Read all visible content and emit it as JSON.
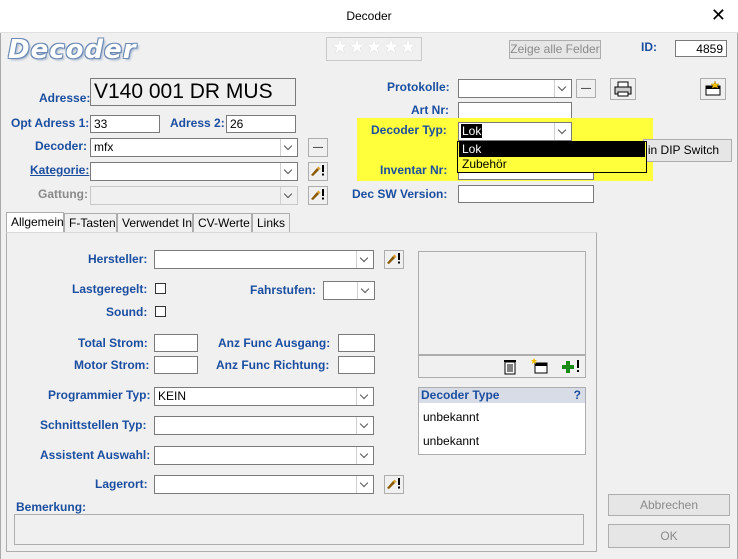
{
  "window": {
    "title": "Decoder",
    "close_glyph": "✕"
  },
  "header": {
    "logo": "Decoder",
    "stars": "★★★★★",
    "show_all_button": "Zeige alle Felder",
    "id_label": "ID:",
    "id_value": "4859"
  },
  "form": {
    "adresse_label": "Adresse:",
    "adresse_value": "V140 001 DR MUS",
    "opt_adress1_label": "Opt Adress 1:",
    "opt_adress1_value": "33",
    "adress2_label": "Adress 2:",
    "adress2_value": "26",
    "decoder_label": "Decoder:",
    "decoder_value": "mfx",
    "kategorie_label": "Kategorie:",
    "gattung_label": "Gattung:",
    "protokolle_label": "Protokolle:",
    "artnr_label": "Art Nr:",
    "decoder_typ_label": "Decoder Typ:",
    "decoder_typ_value": "Lok",
    "inventar_label": "Inventar Nr:",
    "dec_sw_label": "Dec SW Version:",
    "dip_switch_button": "in DIP Switch"
  },
  "dropdown": {
    "options": [
      "Lok",
      "Zubehör"
    ],
    "selected_index": 0
  },
  "tabs": [
    {
      "label": "Allgemein",
      "active": true
    },
    {
      "label": "F-Tasten",
      "active": false
    },
    {
      "label": "Verwendet In",
      "active": false
    },
    {
      "label": "CV-Werte",
      "active": false
    },
    {
      "label": "Links",
      "active": false
    }
  ],
  "general": {
    "hersteller_label": "Hersteller:",
    "lastgeregelt_label": "Lastgeregelt:",
    "sound_label": "Sound:",
    "fahrstufen_label": "Fahrstufen:",
    "total_strom_label": "Total Strom:",
    "motor_strom_label": "Motor Strom:",
    "anz_func_ausgang_label": "Anz Func Ausgang:",
    "anz_func_richtung_label": "Anz Func Richtung:",
    "programmier_typ_label": "Programmier Typ:",
    "programmier_typ_value": "KEIN",
    "schnittstellen_label": "Schnittstellen Typ:",
    "assistent_label": "Assistent Auswahl:",
    "lagerort_label": "Lagerort:",
    "bemerkung_label": "Bemerkung:"
  },
  "decoder_type_panel": {
    "header": "Decoder Type",
    "help": "?",
    "rows": [
      "unbekannt",
      "unbekannt"
    ]
  },
  "buttons": {
    "abbrechen": "Abbrechen",
    "ok": "OK",
    "small_dash": "—"
  },
  "icons": {
    "edit": "pencil-exclamation-icon",
    "printer": "printer-icon",
    "new_window": "new-record-icon",
    "trash": "trash-icon",
    "add_image": "add-image-icon",
    "add": "add-plus-icon"
  }
}
